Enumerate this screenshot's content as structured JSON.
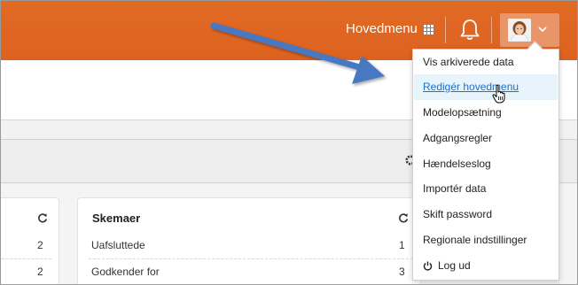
{
  "header": {
    "menu_label": "Hovedmenu",
    "menu_icon": "grid-icon",
    "bell_icon": "bell-icon",
    "user_icon": "avatar",
    "dropdown_icon": "chevron-down-icon",
    "brand_color": "#e0661f"
  },
  "toolbar": {
    "settings_icon": "gear-icon"
  },
  "left_card": {
    "rows": [
      {
        "value": "2"
      },
      {
        "value": "2"
      }
    ]
  },
  "skemaer": {
    "title": "Skemaer",
    "rows": [
      {
        "label": "Uafsluttede",
        "value": "1"
      },
      {
        "label": "Godkender for",
        "value": "3"
      }
    ]
  },
  "user_menu": {
    "items": [
      {
        "label": "Vis arkiverede data"
      },
      {
        "label": "Redigér hovedmenu",
        "hovered": true
      },
      {
        "label": "Modelopsætning"
      },
      {
        "label": "Adgangsregler"
      },
      {
        "label": "Hændelseslog"
      },
      {
        "label": "Importér data"
      },
      {
        "label": "Skift password"
      },
      {
        "label": "Regionale indstillinger"
      },
      {
        "label": "Log ud",
        "icon": "power-icon"
      }
    ]
  },
  "annotation": {
    "arrow_color": "#4a78c2"
  }
}
